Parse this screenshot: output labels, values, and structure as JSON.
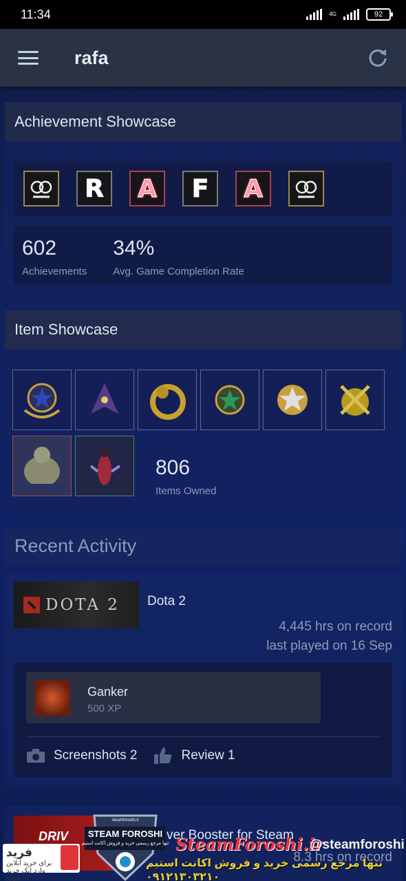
{
  "status": {
    "time": "11:34",
    "network": "4G",
    "battery": "92"
  },
  "appbar": {
    "title": "rafa"
  },
  "achievement_showcase": {
    "title": "Achievement Showcase",
    "letters": [
      "R",
      "A",
      "F",
      "A"
    ],
    "achievements_count": "602",
    "achievements_label": "Achievements",
    "completion_rate": "34%",
    "completion_label": "Avg. Game Completion Rate"
  },
  "item_showcase": {
    "title": "Item Showcase",
    "items_count": "806",
    "items_label": "Items Owned"
  },
  "recent_activity": {
    "title": "Recent Activity",
    "game": {
      "banner_text": "DOTA 2",
      "name": "Dota 2",
      "hours": "4,445 hrs on record",
      "last_played": "last played on 16 Sep",
      "achievement_name": "Ganker",
      "achievement_xp": "500 XP",
      "screenshots": "Screenshots 2",
      "review": "Review 1"
    },
    "next_game": {
      "banner_text": "DRIV",
      "name": "ver Booster for Steam",
      "hours": "8.3 hrs on record"
    }
  },
  "watermark": {
    "site": "SteamForoshi.ir",
    "handle": "@steamforoshi",
    "tagline": "تنها مرجع رسمی خرید و فروش اکانت استیم ۰۹۱۲۱۳۰۳۲۱۰",
    "shield_top": "steamforoshi.ir",
    "shield_title": "STEAM FOROSHI",
    "shield_sub": "تنها مرجع رسمی خرید و فروش اکانت استیم",
    "left_title": "فرید",
    "left_sub": "برای خرید آنلاین وارد اپک خرید شوید"
  }
}
